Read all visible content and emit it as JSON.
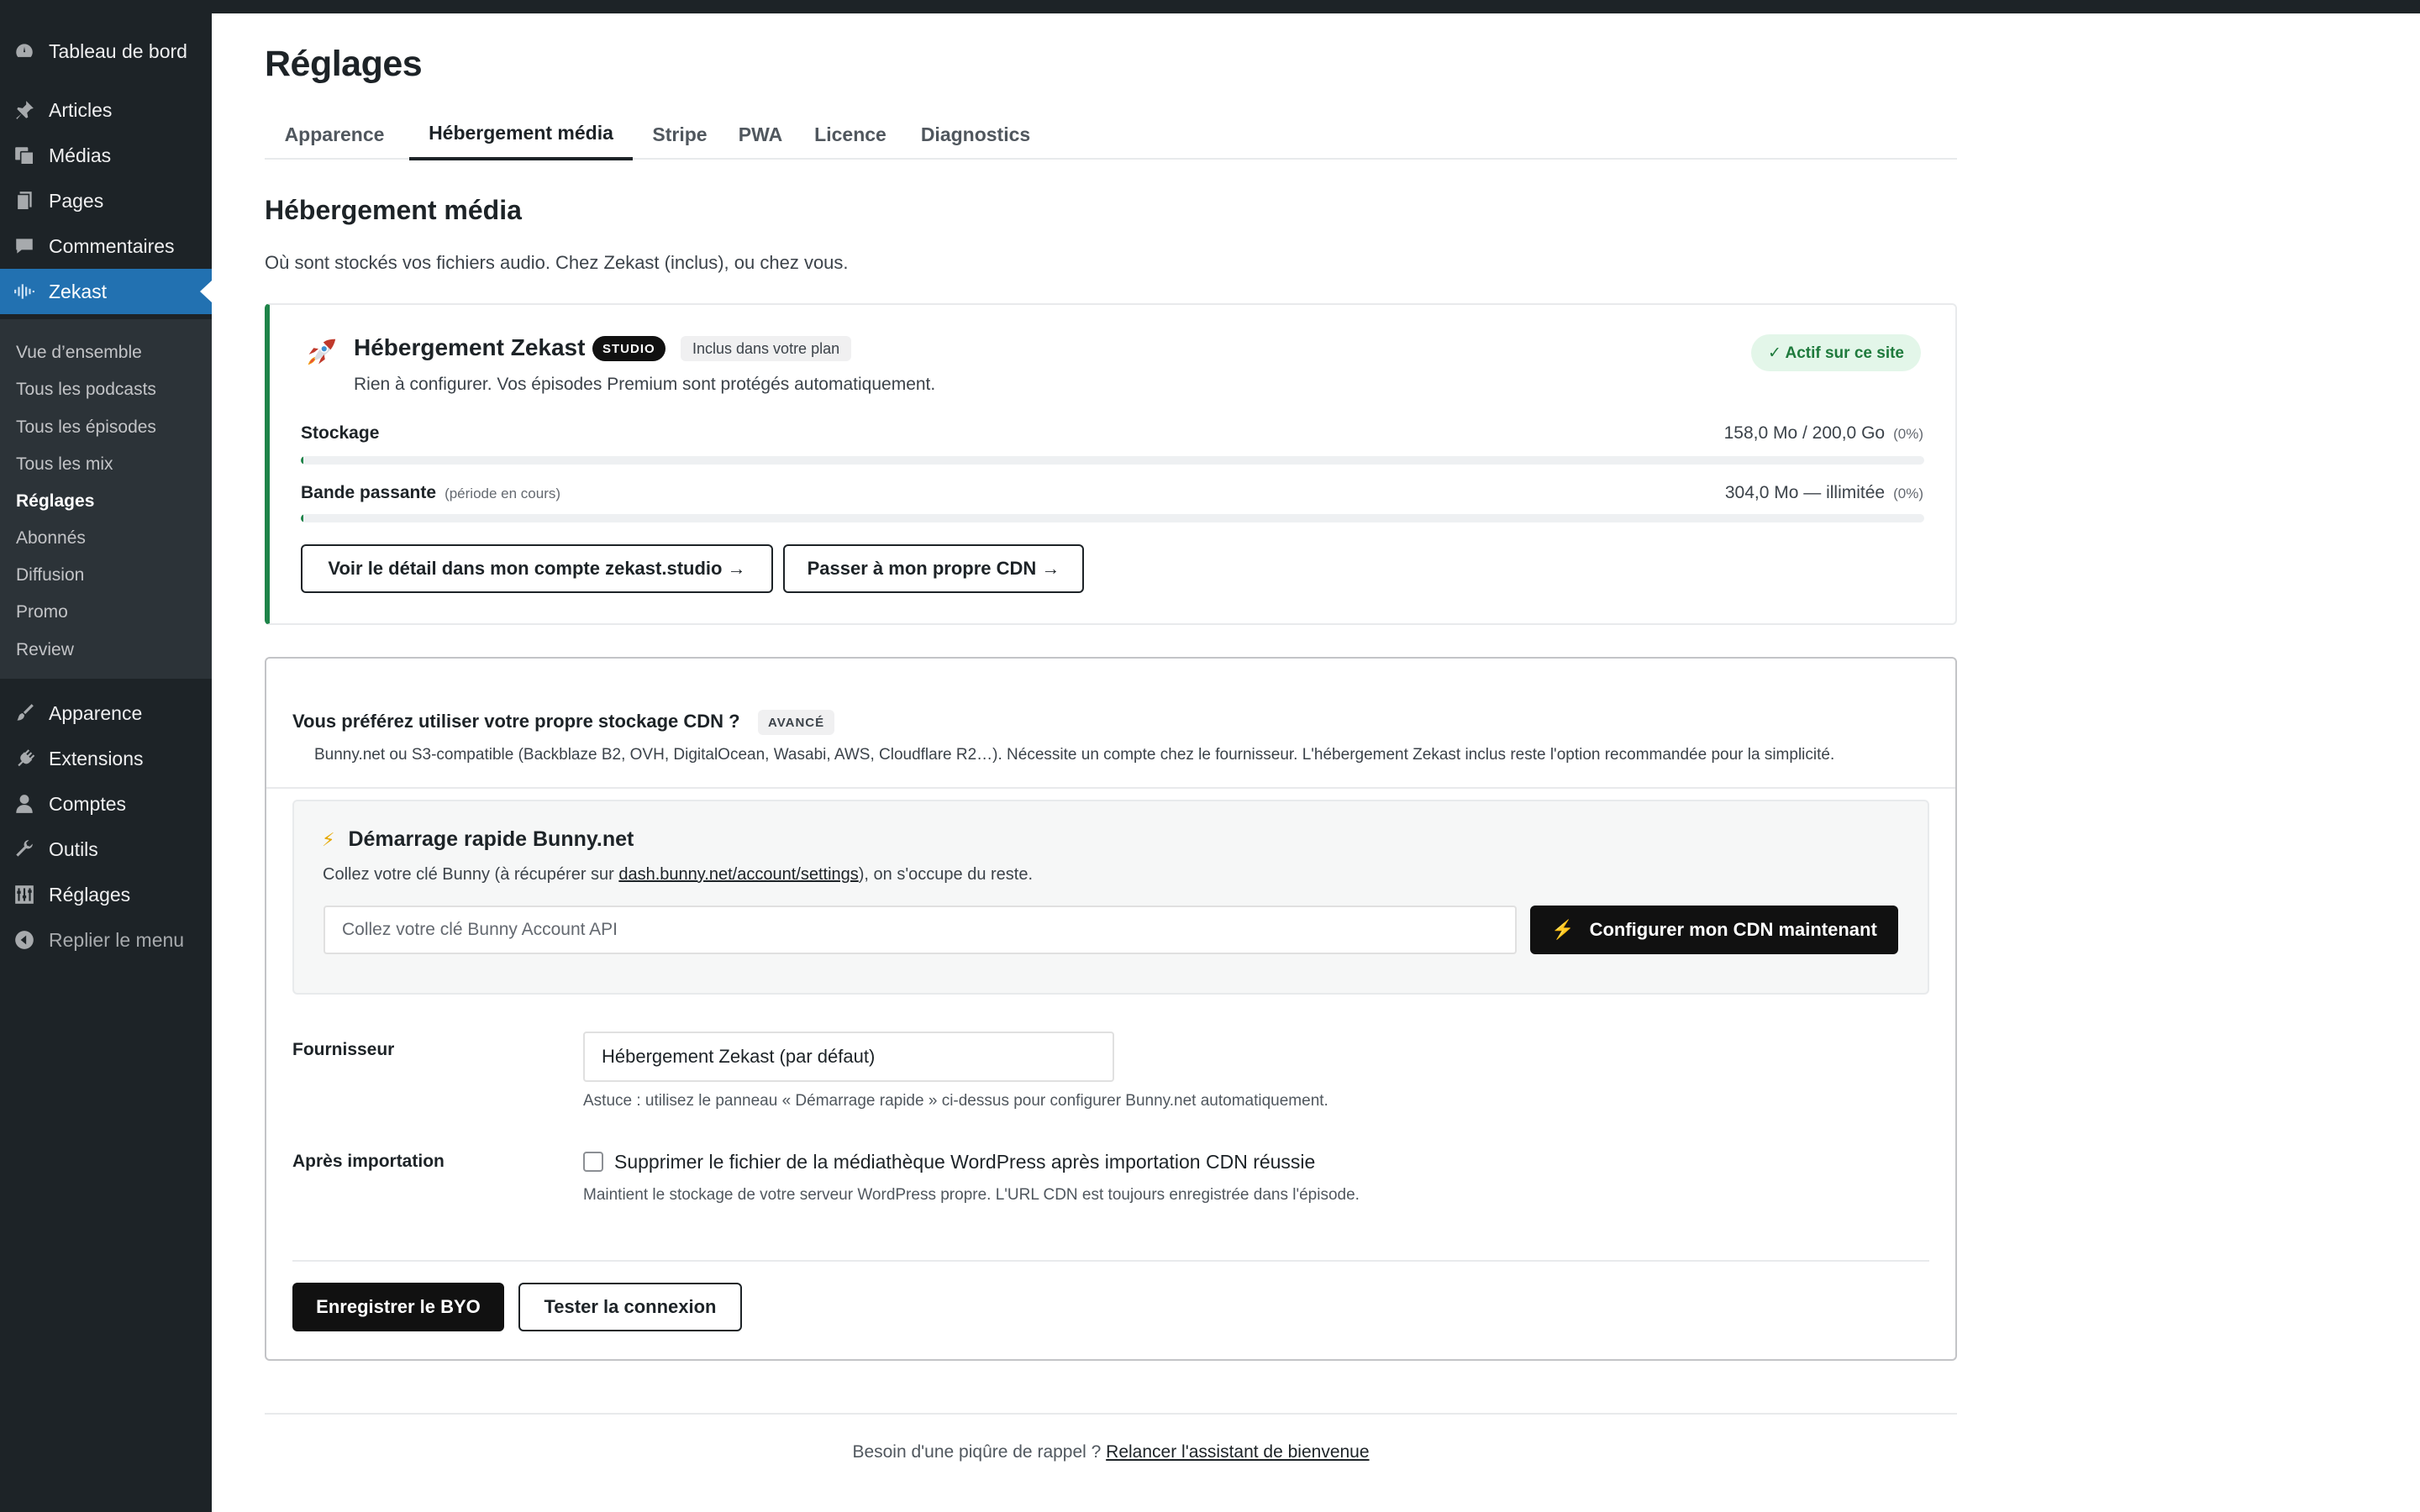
{
  "sidebar": {
    "dashboard": "Tableau de bord",
    "articles": "Articles",
    "medias": "Médias",
    "pages": "Pages",
    "comments": "Commentaires",
    "zekast": "Zekast",
    "submenu": {
      "overview": "Vue d’ensemble",
      "podcasts": "Tous les podcasts",
      "episodes": "Tous les épisodes",
      "mixes": "Tous les mix",
      "settings": "Réglages",
      "subscribers": "Abonnés",
      "broadcast": "Diffusion",
      "promo": "Promo",
      "review": "Review"
    },
    "appearance": "Apparence",
    "extensions": "Extensions",
    "accounts": "Comptes",
    "tools": "Outils",
    "settings": "Réglages",
    "collapse": "Replier le menu"
  },
  "page": {
    "title": "Réglages",
    "tabs": [
      "Apparence",
      "Hébergement média",
      "Stripe",
      "PWA",
      "Licence",
      "Diagnostics"
    ],
    "active_tab": "Hébergement média"
  },
  "section": {
    "title": "Hébergement média",
    "desc": "Où sont stockés vos fichiers audio. Chez Zekast (inclus), ou chez vous."
  },
  "hosting": {
    "title": "Hébergement Zekast",
    "badge": "STUDIO",
    "plan_badge": "Inclus dans votre plan",
    "status": "✓ Actif sur ce site",
    "subtitle": "Rien à configurer. Vos épisodes Premium sont protégés automatiquement.",
    "storage_label": "Stockage",
    "storage_value": "158,0 Mo / 200,0 Go",
    "storage_pct": "(0%)",
    "storage_fraction": 0.0008,
    "bandwidth_label": "Bande passante",
    "bandwidth_note": "(période en cours)",
    "bandwidth_value": "304,0 Mo — illimitée",
    "bandwidth_pct": "(0%)",
    "bandwidth_fraction": 0.001,
    "btn_account": "Voir le détail dans mon compte zekast.studio →",
    "btn_own_cdn": "Passer à mon propre CDN →"
  },
  "cdn": {
    "title": "Vous préférez utiliser votre propre stockage CDN ?",
    "badge": "AVANCÉ",
    "desc": "Bunny.net ou S3-compatible (Backblaze B2, OVH, DigitalOcean, Wasabi, AWS, Cloudflare R2…). Nécessite un compte chez le fournisseur. L'hébergement Zekast inclus reste l'option recommandée pour la simplicité.",
    "quick_title": "Démarrage rapide Bunny.net",
    "quick_desc_before": "Collez votre clé Bunny (à récupérer sur ",
    "quick_link": "dash.bunny.net/account/settings",
    "quick_desc_after": "), on s'occupe du reste.",
    "api_placeholder": "Collez votre clé Bunny Account API",
    "api_value": "",
    "configure_btn": "Configurer mon CDN maintenant",
    "provider_label": "Fournisseur",
    "provider_value": "Hébergement Zekast (par défaut)",
    "provider_hint": "Astuce : utilisez le panneau « Démarrage rapide » ci-dessus pour configurer Bunny.net automatiquement.",
    "after_label": "Après importation",
    "after_checkbox": "Supprimer le fichier de la médiathèque WordPress après importation CDN réussie",
    "after_checked": false,
    "after_hint": "Maintient le stockage de votre serveur WordPress propre. L'URL CDN est toujours enregistrée dans l'épisode.",
    "save_btn": "Enregistrer le BYO",
    "test_btn": "Tester la connexion"
  },
  "footer": {
    "text": "Besoin d'une piqûre de rappel ? ",
    "link": "Relancer l'assistant de bienvenue"
  },
  "colors": {
    "sidebar_bg": "#1d2327",
    "accent": "#2271b1",
    "active_green": "#1e8449",
    "dark_button": "#111111"
  },
  "icons": {
    "dashboard": "gauge-icon",
    "articles": "pin-icon",
    "medias": "media-icon",
    "pages": "pages-icon",
    "comments": "comment-icon",
    "zekast": "waveform-icon",
    "appearance": "brush-icon",
    "extensions": "plug-icon",
    "accounts": "user-icon",
    "tools": "wrench-icon",
    "settings": "settings-icon",
    "collapse": "collapse-icon",
    "rocket": "rocket-icon",
    "bolt": "bolt-icon"
  }
}
